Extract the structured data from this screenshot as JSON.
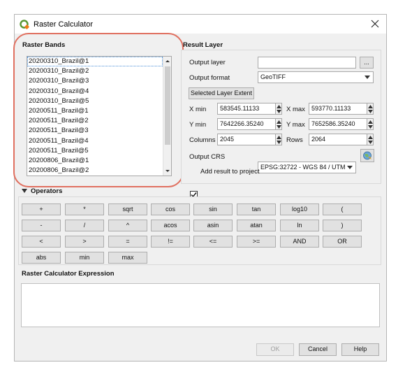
{
  "window": {
    "title": "Raster Calculator"
  },
  "raster_bands": {
    "title": "Raster Bands",
    "items": [
      "20200310_Brazil@1",
      "20200310_Brazil@2",
      "20200310_Brazil@3",
      "20200310_Brazil@4",
      "20200310_Brazil@5",
      "20200511_Brazil@1",
      "20200511_Brazil@2",
      "20200511_Brazil@3",
      "20200511_Brazil@4",
      "20200511_Brazil@5",
      "20200806_Brazil@1",
      "20200806_Brazil@2"
    ]
  },
  "result_layer": {
    "title": "Result Layer",
    "output_layer_label": "Output layer",
    "output_layer_value": "",
    "browse_label": "...",
    "output_format_label": "Output format",
    "output_format_value": "GeoTIFF",
    "selected_extent_label": "Selected Layer Extent",
    "xmin_label": "X min",
    "xmin_value": "583545.11133",
    "xmax_label": "X max",
    "xmax_value": "593770.11133",
    "ymin_label": "Y min",
    "ymin_value": "7642266.35240",
    "ymax_label": "Y max",
    "ymax_value": "7652586.35240",
    "columns_label": "Columns",
    "columns_value": "2045",
    "rows_label": "Rows",
    "rows_value": "2064",
    "crs_label": "Output CRS",
    "crs_value": "EPSG:32722 - WGS 84 / UTM",
    "add_result_label": "Add result to project",
    "add_result_checked": true
  },
  "operators": {
    "title": "Operators",
    "row1": [
      "+",
      "*",
      "sqrt",
      "cos",
      "sin",
      "tan",
      "log10",
      "("
    ],
    "row2": [
      "-",
      "/",
      "^",
      "acos",
      "asin",
      "atan",
      "ln",
      ")"
    ],
    "row3": [
      "<",
      ">",
      "=",
      "!=",
      "<=",
      ">=",
      "AND",
      "OR"
    ],
    "row4": [
      "abs",
      "min",
      "max"
    ]
  },
  "expression": {
    "title": "Raster Calculator Expression",
    "value": ""
  },
  "footer": {
    "ok_label": "OK",
    "cancel_label": "Cancel",
    "help_label": "Help"
  }
}
